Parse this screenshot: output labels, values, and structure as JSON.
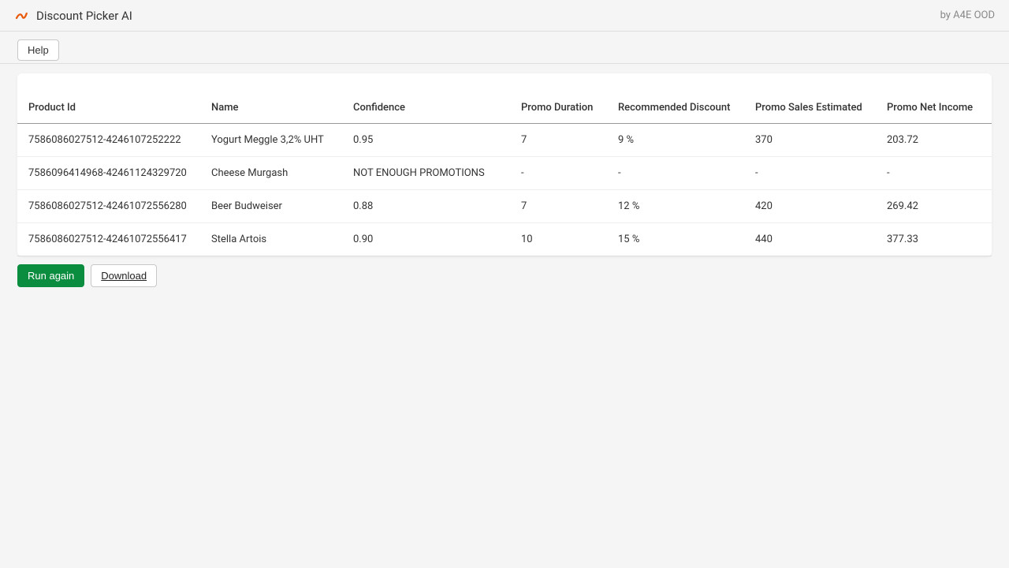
{
  "header": {
    "title": "Discount Picker AI",
    "byline": "by A4E OOD"
  },
  "toolbar": {
    "help_label": "Help"
  },
  "table": {
    "columns": {
      "product_id": "Product Id",
      "name": "Name",
      "confidence": "Confidence",
      "promo_duration": "Promo Duration",
      "recommended_discount": "Recommended Discount",
      "promo_sales": "Promo Sales Estimated",
      "promo_net_income": "Promo Net Income"
    },
    "rows": [
      {
        "product_id": "7586086027512-4246107252222",
        "name": "Yogurt Meggle 3,2% UHT",
        "confidence": "0.95",
        "promo_duration": "7",
        "recommended_discount": "9 %",
        "promo_sales": "370",
        "promo_net_income": "203.72"
      },
      {
        "product_id": "7586096414968-42461124329720",
        "name": "Cheese Murgash",
        "confidence": "NOT ENOUGH PROMOTIONS",
        "promo_duration": "-",
        "recommended_discount": "-",
        "promo_sales": "-",
        "promo_net_income": "-"
      },
      {
        "product_id": "7586086027512-42461072556280",
        "name": "Beer Budweiser",
        "confidence": "0.88",
        "promo_duration": "7",
        "recommended_discount": "12 %",
        "promo_sales": "420",
        "promo_net_income": "269.42"
      },
      {
        "product_id": "7586086027512-42461072556417",
        "name": "Stella Artois",
        "confidence": "0.90",
        "promo_duration": "10",
        "recommended_discount": "15 %",
        "promo_sales": "440",
        "promo_net_income": "377.33"
      }
    ]
  },
  "actions": {
    "run_again_label": "Run again",
    "download_label": "Download"
  }
}
